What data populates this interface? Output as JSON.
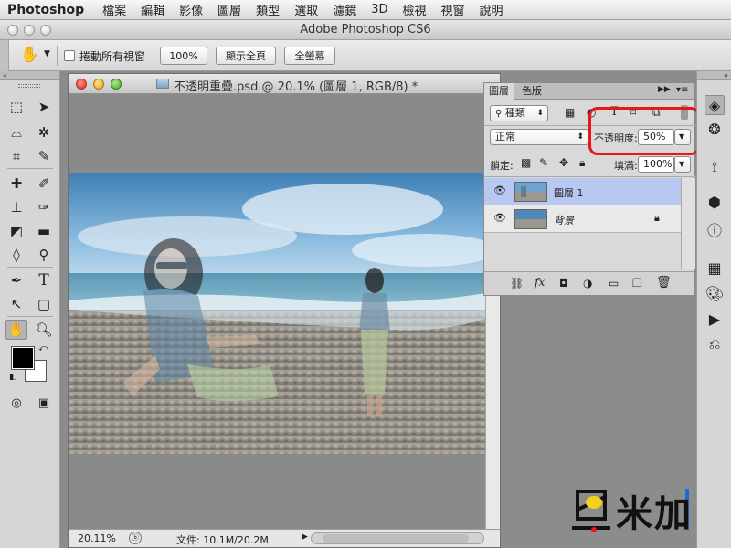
{
  "menubar": {
    "app_name": "Photoshop",
    "items": [
      "檔案",
      "編輯",
      "影像",
      "圖層",
      "類型",
      "選取",
      "濾鏡",
      "3D",
      "檢視",
      "視窗",
      "說明"
    ]
  },
  "window": {
    "title": "Adobe Photoshop CS6"
  },
  "options_bar": {
    "scroll_all_label": "捲動所有視窗",
    "zoom_100_label": "100%",
    "fit_screen_label": "顯示全頁",
    "fill_screen_label": "全螢幕"
  },
  "document": {
    "title": "不透明重疊.psd @ 20.1% (圖層 1, RGB/8) *",
    "zoom": "20.11%",
    "file_info": "文件: 10.1M/20.2M"
  },
  "layers_panel": {
    "tabs": [
      "圖層",
      "色版"
    ],
    "filter_label": "種類",
    "blend_mode": "正常",
    "opacity_label": "不透明度:",
    "opacity_value": "50%",
    "lock_label": "鎖定:",
    "fill_label": "填滿:",
    "fill_value": "100%",
    "layers": [
      {
        "name": "圖層 1",
        "selected": true
      },
      {
        "name": "背景",
        "selected": false
      }
    ]
  },
  "watermark": {
    "text": "米加"
  },
  "colors": {
    "highlight": "#e8161b",
    "selected_layer": "#b8c8f0",
    "foreground": "#000000",
    "background": "#ffffff"
  },
  "icons": {
    "tools": [
      "marquee-icon",
      "move-icon",
      "lasso-icon",
      "magic-wand-icon",
      "crop-icon",
      "eyedropper-icon",
      "healing-brush-icon",
      "brush-icon",
      "clone-stamp-icon",
      "history-brush-icon",
      "eraser-icon",
      "gradient-icon",
      "blur-icon",
      "dodge-icon",
      "pen-icon",
      "type-icon",
      "path-select-icon",
      "shape-icon",
      "hand-icon",
      "zoom-icon"
    ],
    "dock": [
      "layers-icon",
      "channels-icon",
      "paths-icon",
      "3d-icon",
      "info-icon",
      "swatches-icon",
      "styles-icon",
      "actions-icon",
      "history-icon"
    ]
  }
}
